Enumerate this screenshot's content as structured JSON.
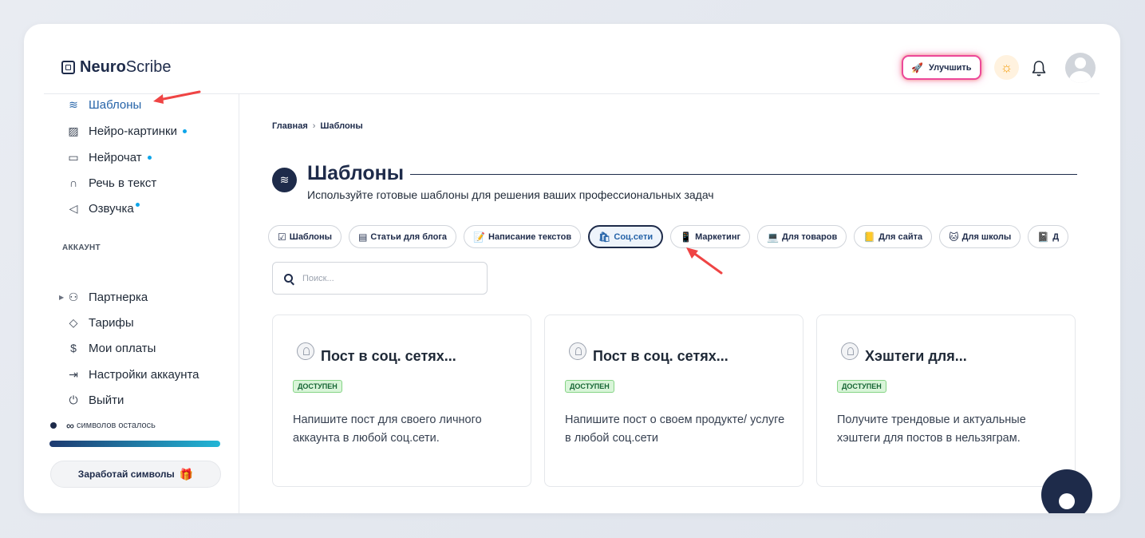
{
  "header": {
    "logo_bold": "Neuro",
    "logo_light": "Scribe",
    "upgrade_label": "Улучшить",
    "icons": [
      "rocket-icon",
      "sun-icon",
      "bell-icon",
      "avatar"
    ]
  },
  "sidebar": {
    "items": [
      {
        "label": "Шаблоны",
        "icon": "layers-icon",
        "active": true
      },
      {
        "label": "Нейро-картинки",
        "icon": "image-icon",
        "dot": true
      },
      {
        "label": "Нейрочат",
        "icon": "chat-icon",
        "dot": true
      },
      {
        "label": "Речь в текст",
        "icon": "headphones-icon"
      },
      {
        "label": "Озвучка",
        "icon": "speaker-icon",
        "dot": true
      }
    ],
    "account_section": "АККАУНТ",
    "account_items": [
      {
        "label": "Партнерка",
        "icon": "users-icon",
        "expandable": true
      },
      {
        "label": "Тарифы",
        "icon": "tag-icon"
      },
      {
        "label": "Мои оплаты",
        "icon": "dollar-icon"
      },
      {
        "label": "Настройки аккаунта",
        "icon": "login-icon"
      },
      {
        "label": "Выйти",
        "icon": "power-icon"
      }
    ],
    "symbols": {
      "value": "∞",
      "label": "символов осталось",
      "progress": 1.0
    },
    "earn_label": "Заработай символы"
  },
  "breadcrumb": {
    "home": "Главная",
    "separator": "›",
    "current": "Шаблоны"
  },
  "page": {
    "title": "Шаблоны",
    "subtitle": "Используйте готовые шаблоны для решения ваших профессиональных задач"
  },
  "categories": [
    {
      "emoji": "☑",
      "label": "Шаблоны"
    },
    {
      "emoji": "▤",
      "label": "Статьи для блога"
    },
    {
      "emoji": "📝",
      "label": "Написание текстов"
    },
    {
      "emoji": "🛍",
      "label": "Соц.сети",
      "selected": true
    },
    {
      "emoji": "📱",
      "label": "Маркетинг"
    },
    {
      "emoji": "💻",
      "label": "Для товаров"
    },
    {
      "emoji": "📒",
      "label": "Для сайта"
    },
    {
      "emoji": "🐱",
      "label": "Для школы"
    },
    {
      "emoji": "📓",
      "label": "Д"
    }
  ],
  "search": {
    "placeholder": "Поиск..."
  },
  "cards": [
    {
      "title": "Пост в соц. сетях...",
      "badge": "ДОСТУПЕН",
      "description": "Напишите пост для своего личного аккаунта в любой соц.сети."
    },
    {
      "title": "Пост в соц. сетях...",
      "badge": "ДОСТУПЕН",
      "description": "Напишите пост о своем продукте/ услуге в любой соц.сети"
    },
    {
      "title": "Хэштеги для...",
      "badge": "ДОСТУПЕН",
      "description": "Получите трендовые и актуальные хэштеги для постов в нельзяграм."
    }
  ],
  "colors": {
    "accent": "#1e2b4a",
    "active": "#2563a8",
    "badge": "#d9f5d9",
    "annotation": "#ef4444"
  }
}
